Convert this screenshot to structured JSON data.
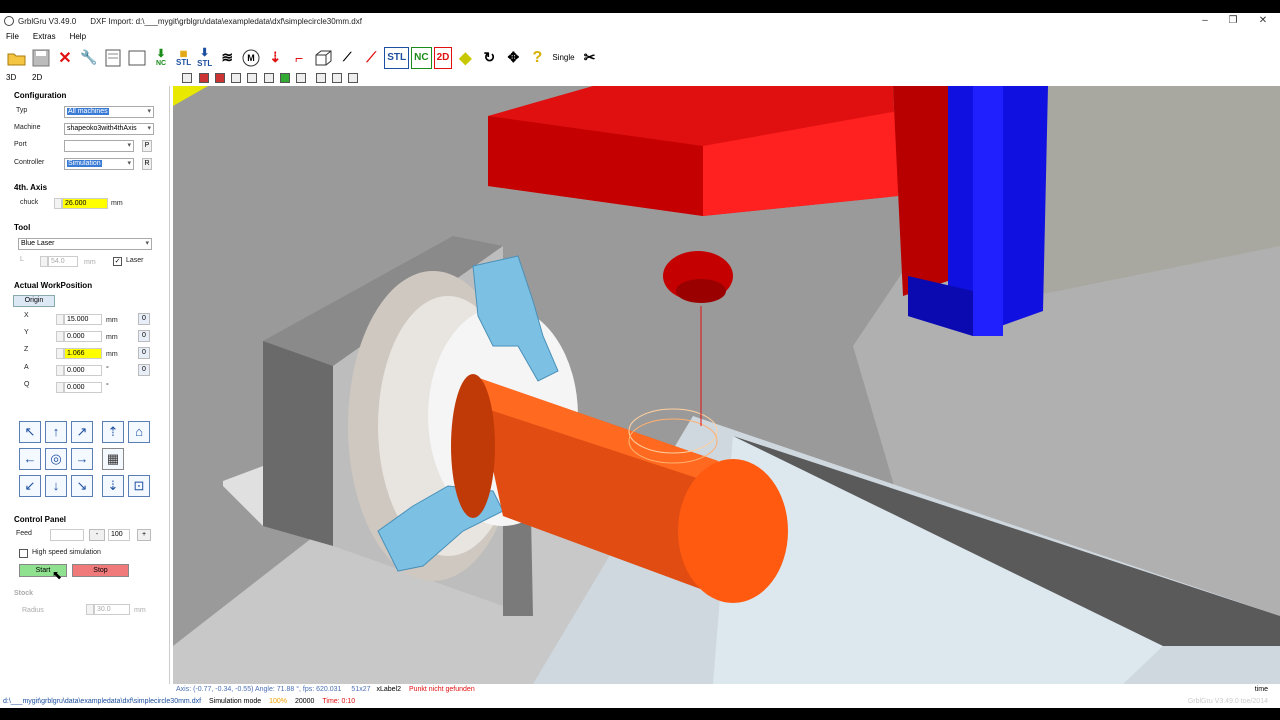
{
  "window": {
    "title": "GrblGru V3.49.0",
    "subtitle": "DXF Import: d:\\___mygit\\grblgru\\data\\exampledata\\dxf\\simplecircle30mm.dxf"
  },
  "menu": [
    "File",
    "Extras",
    "Help"
  ],
  "toolbar": {
    "stl1": "STL",
    "nc1": "NC",
    "stl2": "STL",
    "nc2": "NC",
    "d2": "2D",
    "single": "Single"
  },
  "tabs": {
    "t3d": "3D",
    "t2d": "2D"
  },
  "config": {
    "title": "Configuration",
    "typ_label": "Typ",
    "typ_value": "All machines",
    "machine_label": "Machine",
    "machine_value": "shapeoko3with4thAxis",
    "port_label": "Port",
    "port_value": "",
    "port_btn": "P",
    "controller_label": "Controller",
    "controller_value": "Simulation",
    "controller_btn": "R"
  },
  "axis4": {
    "title": "4th. Axis",
    "chuck_label": "chuck",
    "chuck_value": "26.000",
    "unit": "mm"
  },
  "tool": {
    "title": "Tool",
    "value": "Blue Laser",
    "l_label": "L",
    "l_value": "54.0",
    "l_unit": "mm",
    "laser_label": "Laser"
  },
  "workpos": {
    "title": "Actual WorkPosition",
    "origin": "Origin",
    "rows": [
      {
        "label": "X",
        "value": "15.000",
        "unit": "mm",
        "zero": "0"
      },
      {
        "label": "Y",
        "value": "0.000",
        "unit": "mm",
        "zero": "0"
      },
      {
        "label": "Z",
        "value": "1.066",
        "unit": "mm",
        "zero": "0"
      },
      {
        "label": "A",
        "value": "0.000",
        "unit": "°",
        "zero": "0"
      },
      {
        "label": "Q",
        "value": "0.000",
        "unit": "°",
        "zero": ""
      }
    ]
  },
  "control": {
    "title": "Control Panel",
    "feed_label": "Feed",
    "feed_value": "",
    "minus": "-",
    "feed_pct": "100",
    "plus": "+",
    "hss_label": "High speed simulation",
    "start": "Start",
    "stop": "Stop"
  },
  "stock": {
    "title": "Stock",
    "radius_label": "Radius",
    "radius_value": "30.0",
    "unit": "mm"
  },
  "status1": {
    "axis": "Axis: (-0.77, -0.34, -0.55) Angle: 71.88 °, fps: 620.031",
    "size": "51x27",
    "xlabel": "xLabel2",
    "error": "Punkt nicht gefunden",
    "time": "time"
  },
  "status2": {
    "path": "d:\\___mygit\\grblgru\\data\\exampledata\\dxf\\simplecircle30mm.dxf",
    "mode": "Simulation mode",
    "pct": "100%",
    "count": "20000",
    "time": "Time: 0:10",
    "version": "GrblGru V3.49.0 toe/2014"
  }
}
